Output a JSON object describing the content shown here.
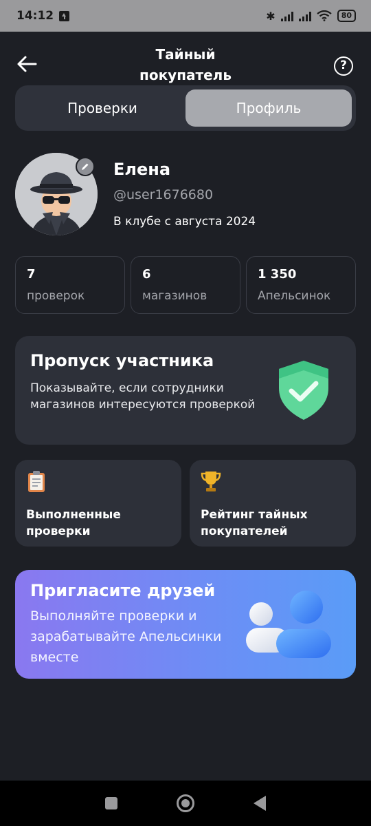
{
  "status_bar": {
    "time": "14:12",
    "battery": "80"
  },
  "header": {
    "title": "Тайный покупатель"
  },
  "tabs": [
    {
      "label": "Проверки",
      "active": false
    },
    {
      "label": "Профиль",
      "active": true
    }
  ],
  "profile": {
    "name": "Елена",
    "username": "@user1676680",
    "member_since": "В клубе с августа 2024"
  },
  "stats": [
    {
      "value": "7",
      "label": "проверок"
    },
    {
      "value": "6",
      "label": "магазинов"
    },
    {
      "value": "1 350",
      "label": "Апельсинок"
    }
  ],
  "pass_card": {
    "title": "Пропуск участника",
    "description": "Показывайте, если сотрудники магазинов интересуются проверкой",
    "icon": "shield-check-icon"
  },
  "mini_cards": [
    {
      "label": "Выполненные проверки",
      "icon": "clipboard-icon"
    },
    {
      "label": "Рейтинг тайных покупателей",
      "icon": "trophy-icon"
    }
  ],
  "invite": {
    "title": "Пригласите друзей",
    "description": "Выполняйте проверки и зарабатывайте Апельсинки вместе",
    "icon": "friends-icon"
  },
  "colors": {
    "background": "#1d1f25",
    "card": "#2d3039",
    "active_tab": "#a7a9ae",
    "accent_green": "#5fd79a",
    "invite_gradient_start": "#8a78f0",
    "invite_gradient_end": "#5a9cf7"
  }
}
